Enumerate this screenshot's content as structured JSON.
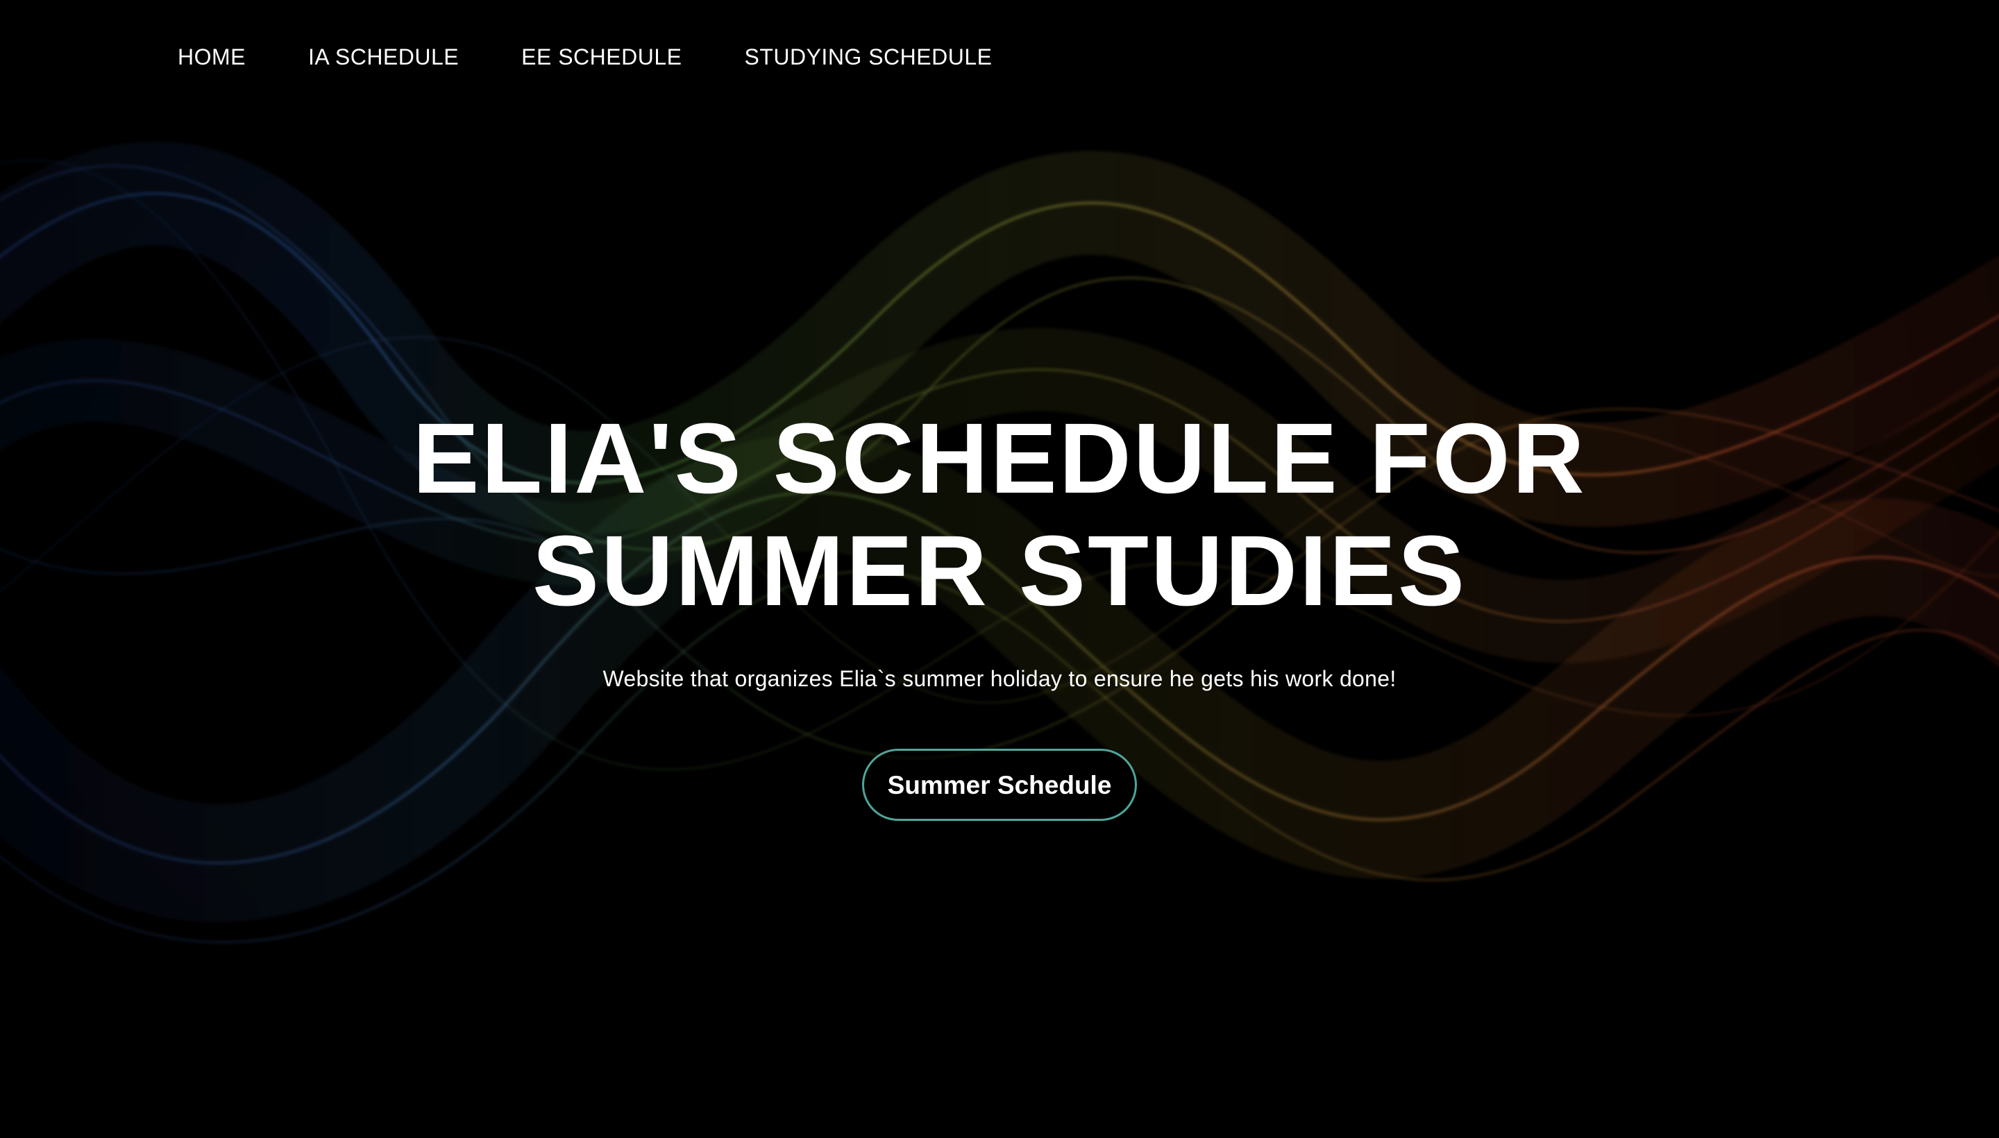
{
  "nav": {
    "items": [
      {
        "label": "HOME"
      },
      {
        "label": "IA SCHEDULE"
      },
      {
        "label": "EE SCHEDULE"
      },
      {
        "label": "STUDYING SCHEDULE"
      }
    ]
  },
  "hero": {
    "title": "ELIA'S SCHEDULE FOR SUMMER STUDIES",
    "subtitle": "Website that organizes Elia`s summer holiday to ensure he gets his work done!",
    "button_label": "Summer Schedule"
  },
  "colors": {
    "background": "#000000",
    "button_border": "#4fa59a",
    "wave_blue": "#2a4f9e",
    "wave_green": "#5e8a3a",
    "wave_yellow": "#a39a3b",
    "wave_orange": "#c8532a"
  }
}
